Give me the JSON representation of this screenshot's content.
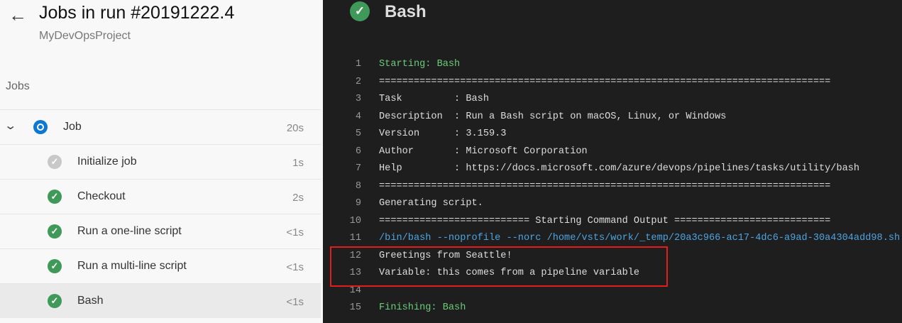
{
  "header": {
    "title": "Jobs in run #20191222.4",
    "project": "MyDevOpsProject"
  },
  "jobs_heading": "Jobs",
  "job": {
    "label": "Job",
    "duration": "20s"
  },
  "steps": [
    {
      "label": "Initialize job",
      "duration": "1s",
      "status": "pending"
    },
    {
      "label": "Checkout",
      "duration": "2s",
      "status": "success"
    },
    {
      "label": "Run a one-line script",
      "duration": "<1s",
      "status": "success"
    },
    {
      "label": "Run a multi-line script",
      "duration": "<1s",
      "status": "success"
    },
    {
      "label": "Bash",
      "duration": "<1s",
      "status": "success"
    }
  ],
  "log": {
    "title": "Bash",
    "lines": [
      {
        "n": "1",
        "t": "Starting: Bash"
      },
      {
        "n": "2",
        "t": "=============================================================================="
      },
      {
        "n": "3",
        "t": "Task         : Bash"
      },
      {
        "n": "4",
        "t": "Description  : Run a Bash script on macOS, Linux, or Windows"
      },
      {
        "n": "5",
        "t": "Version      : 3.159.3"
      },
      {
        "n": "6",
        "t": "Author       : Microsoft Corporation"
      },
      {
        "n": "7",
        "t": "Help         : https://docs.microsoft.com/azure/devops/pipelines/tasks/utility/bash"
      },
      {
        "n": "8",
        "t": "=============================================================================="
      },
      {
        "n": "9",
        "t": "Generating script."
      },
      {
        "n": "10",
        "t": "========================== Starting Command Output ==========================="
      },
      {
        "n": "11",
        "t": "/bin/bash --noprofile --norc /home/vsts/work/_temp/20a3c966-ac17-4dc6-a9ad-30a4304add98.sh"
      },
      {
        "n": "12",
        "t": "Greetings from Seattle!"
      },
      {
        "n": "13",
        "t": "Variable: this comes from a pipeline variable"
      },
      {
        "n": "14",
        "t": ""
      },
      {
        "n": "15",
        "t": "Finishing: Bash"
      }
    ]
  }
}
